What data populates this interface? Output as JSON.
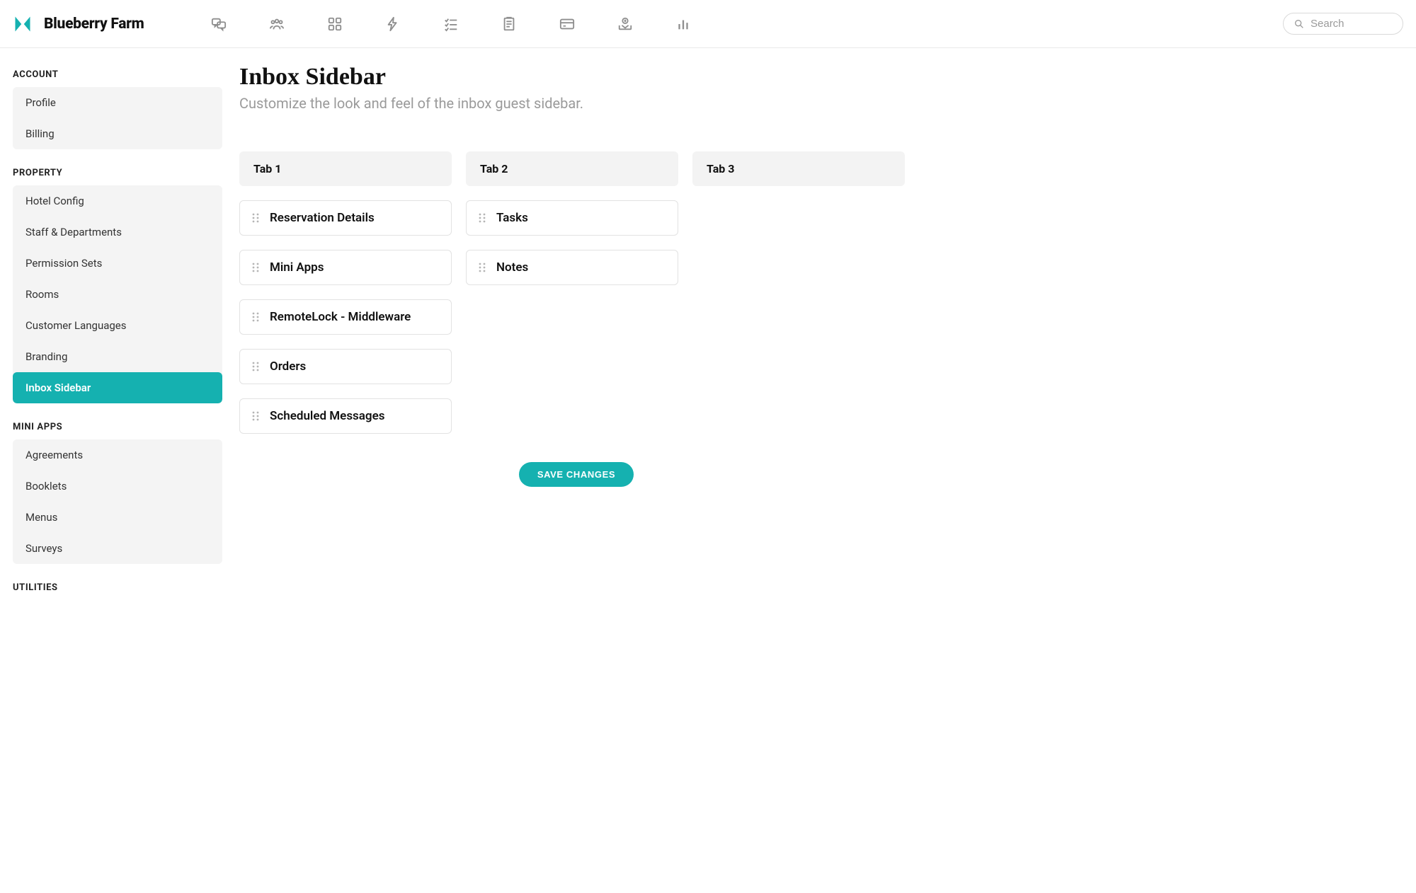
{
  "header": {
    "brand": "Blueberry Farm",
    "search_placeholder": "Search",
    "nav_icons": [
      "messages-icon",
      "people-icon",
      "apps-icon",
      "bolt-icon",
      "checklist-icon",
      "clipboard-icon",
      "card-icon",
      "money-inbox-icon",
      "stats-icon"
    ]
  },
  "sidebar": {
    "sections": [
      {
        "heading": "ACCOUNT",
        "items": [
          {
            "label": "Profile",
            "active": false
          },
          {
            "label": "Billing",
            "active": false
          }
        ]
      },
      {
        "heading": "PROPERTY",
        "items": [
          {
            "label": "Hotel Config",
            "active": false
          },
          {
            "label": "Staff & Departments",
            "active": false
          },
          {
            "label": "Permission Sets",
            "active": false
          },
          {
            "label": "Rooms",
            "active": false
          },
          {
            "label": "Customer Languages",
            "active": false
          },
          {
            "label": "Branding",
            "active": false
          },
          {
            "label": "Inbox Sidebar",
            "active": true
          }
        ]
      },
      {
        "heading": "MINI APPS",
        "items": [
          {
            "label": "Agreements",
            "active": false
          },
          {
            "label": "Booklets",
            "active": false
          },
          {
            "label": "Menus",
            "active": false
          },
          {
            "label": "Surveys",
            "active": false
          }
        ]
      },
      {
        "heading": "UTILITIES",
        "items": []
      }
    ]
  },
  "main": {
    "title": "Inbox Sidebar",
    "subtitle": "Customize the look and feel of the inbox guest sidebar.",
    "tabs": [
      {
        "title": "Tab 1",
        "cards": [
          "Reservation Details",
          "Mini Apps",
          "RemoteLock - Middleware",
          "Orders",
          "Scheduled Messages"
        ]
      },
      {
        "title": "Tab 2",
        "cards": [
          "Tasks",
          "Notes"
        ]
      },
      {
        "title": "Tab 3",
        "cards": []
      }
    ],
    "save_label": "SAVE CHANGES"
  },
  "colors": {
    "accent": "#15b1b0"
  }
}
